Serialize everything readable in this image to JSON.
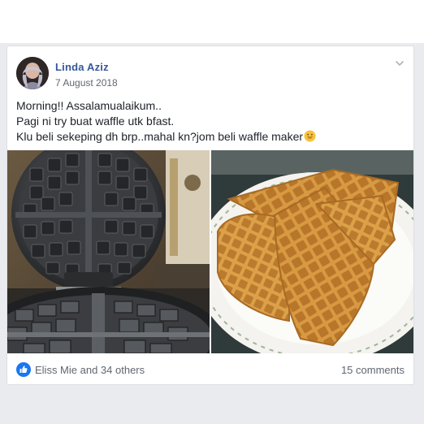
{
  "post": {
    "author": "Linda Aziz",
    "date": "7 August 2018",
    "text_lines": [
      "Morning!! Assalamualaikum..",
      "Pagi ni try buat waffle utk bfast.",
      "Klu beli sekeping dh brp..mahal kn?jom beli waffle maker"
    ],
    "emoji": "grinning-face-emoji",
    "photos": [
      "waffle-maker-photo",
      "waffles-plate-photo"
    ],
    "reactions_text": "Eliss Mie and 34 others",
    "comments_text": "15 comments"
  },
  "icons": {
    "menu": "chevron-down-icon",
    "like": "like-icon"
  },
  "colors": {
    "author_link": "#365899",
    "like_blue": "#1877f2",
    "text": "#1d2129",
    "meta": "#606770",
    "page_bg": "#e9ebee"
  }
}
